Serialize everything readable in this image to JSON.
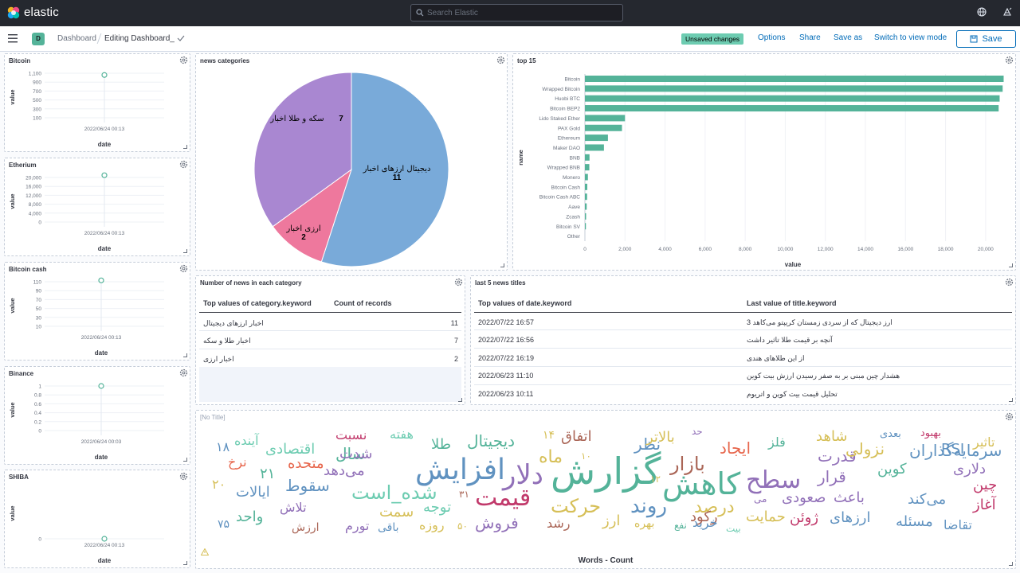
{
  "header": {
    "brand": "elastic",
    "search_placeholder": "Search Elastic"
  },
  "subbar": {
    "avatar_letter": "D",
    "breadcrumb_root": "Dashboard",
    "breadcrumb_current": "Editing Dashboard_",
    "badge": "Unsaved changes",
    "links": [
      "Options",
      "Share",
      "Save as",
      "Switch to view mode"
    ],
    "save_label": "Save"
  },
  "colors": {
    "accent": "#006bb8",
    "bar": "#54b399",
    "pie": [
      "#79aad9",
      "#ee789d",
      "#a987d1"
    ],
    "line_point": "#54b399"
  },
  "mini_charts": [
    {
      "title": "Bitcoin",
      "y_ticks": [
        "1,100",
        "900",
        "700",
        "500",
        "300",
        "100"
      ],
      "x_tick": "2022/06/24 00:13",
      "ylabel": "value",
      "xlabel": "date"
    },
    {
      "title": "Etherium",
      "y_ticks": [
        "20,000",
        "16,000",
        "12,000",
        "8,000",
        "4,000",
        "0"
      ],
      "x_tick": "2022/06/24 00:13",
      "ylabel": "value",
      "xlabel": "date"
    },
    {
      "title": "Bitcoin cash",
      "y_ticks": [
        "110",
        "90",
        "70",
        "50",
        "30",
        "10"
      ],
      "x_tick": "2022/06/24 00:13",
      "ylabel": "value",
      "xlabel": "date"
    },
    {
      "title": "Binance",
      "y_ticks": [
        "1",
        "0.8",
        "0.6",
        "0.4",
        "0.2",
        "0"
      ],
      "x_tick": "2022/06/24 00:03",
      "ylabel": "value",
      "xlabel": "date"
    },
    {
      "title": "SHIBA",
      "y_ticks": [
        "0"
      ],
      "x_tick": "2022/06/24 00:13",
      "ylabel": "value",
      "xlabel": "date"
    }
  ],
  "pie_panel": {
    "title": "news categories"
  },
  "bar_panel": {
    "title": "top 15"
  },
  "count_table": {
    "title": "Number of news in each category",
    "headers": [
      "Top values of category.keyword",
      "Count of records"
    ],
    "rows": [
      [
        "اخبار ارزهای دیجیتال",
        "11"
      ],
      [
        "اخبار طلا و سکه",
        "7"
      ],
      [
        "اخبار ارزی",
        "2"
      ]
    ]
  },
  "news_table": {
    "title": "last 5 news titles",
    "headers": [
      "Top values of date.keyword",
      "Last value of title.keyword"
    ],
    "rows": [
      [
        "2022/07/22 16:57",
        "ارز دیجیتال که از سردی زمستان کریپتو می‌کاهد 3"
      ],
      [
        "2022/07/22 16:56",
        "آنچه بر قیمت طلا تاثیر داشت"
      ],
      [
        "2022/07/22 16:19",
        "از این طلاهای هندی"
      ],
      [
        "2022/06/23 11:10",
        "هشدار چین مبنی بر به صفر رسیدن ارزش بیت کوین"
      ],
      [
        "2022/06/23 10:11",
        "تحلیل قیمت بیت کوین و اتریوم"
      ]
    ]
  },
  "cloud_panel": {
    "title": "[No Title]",
    "footer": "Words - Count"
  },
  "chart_data": [
    {
      "type": "line",
      "title": "Bitcoin",
      "x": [
        "2022/06/24 00:13"
      ],
      "y": [
        1060
      ],
      "xlabel": "date",
      "ylabel": "value",
      "ylim": [
        100,
        1100
      ]
    },
    {
      "type": "line",
      "title": "Etherium",
      "x": [
        "2022/06/24 00:13"
      ],
      "y": [
        21000
      ],
      "xlabel": "date",
      "ylabel": "value",
      "ylim": [
        0,
        20000
      ]
    },
    {
      "type": "line",
      "title": "Bitcoin cash",
      "x": [
        "2022/06/24 00:13"
      ],
      "y": [
        113
      ],
      "xlabel": "date",
      "ylabel": "value",
      "ylim": [
        10,
        110
      ]
    },
    {
      "type": "line",
      "title": "Binance",
      "x": [
        "2022/06/24 00:03"
      ],
      "y": [
        1
      ],
      "xlabel": "date",
      "ylabel": "value",
      "ylim": [
        0,
        1
      ]
    },
    {
      "type": "line",
      "title": "SHIBA",
      "x": [
        "2022/06/24 00:13"
      ],
      "y": [
        0
      ],
      "xlabel": "date",
      "ylabel": "value",
      "ylim": [
        0,
        0
      ]
    },
    {
      "type": "pie",
      "title": "news categories",
      "slices": [
        {
          "label": "دیجیتال ارزهای اخبار",
          "value": 11
        },
        {
          "label": "ارزی اخبار",
          "value": 2
        },
        {
          "label": "سکه و طلا اخبار",
          "value": 7
        }
      ]
    },
    {
      "type": "bar",
      "orientation": "horizontal",
      "title": "top 15",
      "xlabel": "value",
      "ylabel": "name",
      "categories": [
        "Bitcoin",
        "Wrapped Bitcoin",
        "Huobi BTC",
        "Bitcoin BEP2",
        "Lido Staked Ether",
        "PAX Gold",
        "Ethereum",
        "Maker DAO",
        "BNB",
        "Wrapped BNB",
        "Monero",
        "Bitcoin Cash",
        "Bitcoin Cash ABC",
        "Aave",
        "Zcash",
        "Bitcoin SV",
        "Other"
      ],
      "values": [
        20900,
        20850,
        20700,
        20650,
        2000,
        1850,
        1150,
        950,
        230,
        220,
        150,
        120,
        110,
        90,
        60,
        50,
        0
      ],
      "x_ticks": [
        "0",
        "2,000",
        "4,000",
        "6,000",
        "8,000",
        "10,000",
        "12,000",
        "14,000",
        "16,000",
        "18,000",
        "20,000"
      ],
      "xlim": [
        0,
        21000
      ]
    },
    {
      "type": "wordcloud",
      "title": "[No Title]",
      "xlabel": "Words - Count",
      "words": [
        {
          "text": "گزارش",
          "size": 46,
          "color": "#54b399"
        },
        {
          "text": "کاهش",
          "size": 38,
          "color": "#54b399"
        },
        {
          "text": "افزایش",
          "size": 36,
          "color": "#6092c0"
        },
        {
          "text": "دلار",
          "size": 34,
          "color": "#9170b8"
        },
        {
          "text": "قیمت",
          "size": 30,
          "color": "#c1396b"
        },
        {
          "text": "سطح",
          "size": 30,
          "color": "#9170b8"
        },
        {
          "text": "روند",
          "size": 26,
          "color": "#6092c0"
        },
        {
          "text": "حرکت",
          "size": 24,
          "color": "#d6bf57"
        },
        {
          "text": "شده_است",
          "size": 24,
          "color": "#6dccb1"
        },
        {
          "text": "بازار",
          "size": 24,
          "color": "#aa6556"
        },
        {
          "text": "درصد",
          "size": 22,
          "color": "#d6bf57"
        },
        {
          "text": "ماه",
          "size": 22,
          "color": "#d6bf57"
        },
        {
          "text": "دیجیتال",
          "size": 20,
          "color": "#54b399"
        },
        {
          "text": "ایجاد",
          "size": 20,
          "color": "#e7664c"
        },
        {
          "text": "نظر",
          "size": 20,
          "color": "#6092c0"
        },
        {
          "text": "سقوط",
          "size": 20,
          "color": "#6092c0"
        },
        {
          "text": "فروش",
          "size": 20,
          "color": "#9170b8"
        },
        {
          "text": "قرار",
          "size": 20,
          "color": "#9170b8"
        },
        {
          "text": "قدرت",
          "size": 20,
          "color": "#9170b8"
        },
        {
          "text": "نزولی",
          "size": 20,
          "color": "#d6bf57"
        },
        {
          "text": "سرمایه‌گذاران",
          "size": 20,
          "color": "#6092c0"
        },
        {
          "text": "سال",
          "size": 20,
          "color": "#54b399"
        },
        {
          "text": "شدت",
          "size": 18,
          "color": "#9170b8"
        },
        {
          "text": "می‌دهد",
          "size": 18,
          "color": "#9170b8"
        },
        {
          "text": "صعودی",
          "size": 18,
          "color": "#9170b8"
        },
        {
          "text": "باعث",
          "size": 18,
          "color": "#9170b8"
        },
        {
          "text": "حمایت",
          "size": 18,
          "color": "#d6bf57"
        },
        {
          "text": "رکود",
          "size": 18,
          "color": "#aa6556"
        },
        {
          "text": "اتفاق",
          "size": 18,
          "color": "#aa6556"
        },
        {
          "text": "طلا",
          "size": 18,
          "color": "#54b399"
        },
        {
          "text": "اقتصادی",
          "size": 18,
          "color": "#6dccb1"
        },
        {
          "text": "متحده",
          "size": 18,
          "color": "#e7664c"
        },
        {
          "text": "ایالات",
          "size": 18,
          "color": "#6092c0"
        },
        {
          "text": "کوین",
          "size": 18,
          "color": "#54b399"
        },
        {
          "text": "می‌کند",
          "size": 18,
          "color": "#6092c0"
        },
        {
          "text": "دلاری",
          "size": 18,
          "color": "#9170b8"
        },
        {
          "text": "RSI",
          "size": 18,
          "color": "#6092c0"
        },
        {
          "text": "شاهد",
          "size": 18,
          "color": "#d6bf57"
        },
        {
          "text": "چین",
          "size": 18,
          "color": "#c1396b"
        },
        {
          "text": "آغاز",
          "size": 18,
          "color": "#c1396b"
        },
        {
          "text": "ژوئن",
          "size": 18,
          "color": "#c1396b"
        },
        {
          "text": "ارزهای",
          "size": 18,
          "color": "#6092c0"
        },
        {
          "text": "مسئله",
          "size": 18,
          "color": "#6092c0"
        },
        {
          "text": "خرید",
          "size": 16,
          "color": "#6092c0"
        },
        {
          "text": "بالاتر",
          "size": 18,
          "color": "#d6bf57"
        },
        {
          "text": "تلاش",
          "size": 16,
          "color": "#9170b8"
        },
        {
          "text": "سمت",
          "size": 18,
          "color": "#d6bf57"
        },
        {
          "text": "توجه",
          "size": 18,
          "color": "#6dccb1"
        },
        {
          "text": "واحد",
          "size": 18,
          "color": "#54b399"
        },
        {
          "text": "تورم",
          "size": 16,
          "color": "#9170b8"
        },
        {
          "text": "روزه",
          "size": 16,
          "color": "#d6bf57"
        },
        {
          "text": "رشد",
          "size": 16,
          "color": "#aa6556"
        },
        {
          "text": "ارز",
          "size": 18,
          "color": "#d6bf57"
        },
        {
          "text": "بهره",
          "size": 14,
          "color": "#d6bf57"
        },
        {
          "text": "نرخ",
          "size": 16,
          "color": "#e7664c"
        },
        {
          "text": "آینده",
          "size": 16,
          "color": "#6dccb1"
        },
        {
          "text": "نسبت",
          "size": 16,
          "color": "#c1396b"
        },
        {
          "text": "هفته",
          "size": 16,
          "color": "#6dccb1"
        },
        {
          "text": "فلز",
          "size": 16,
          "color": "#54b399"
        },
        {
          "text": "بهبود",
          "size": 13,
          "color": "#c1396b"
        },
        {
          "text": "بعدی",
          "size": 13,
          "color": "#6092c0"
        },
        {
          "text": "تاثیر",
          "size": 16,
          "color": "#d6bf57"
        },
        {
          "text": "تقاضا",
          "size": 16,
          "color": "#6092c0"
        },
        {
          "text": "باقی",
          "size": 14,
          "color": "#6092c0"
        },
        {
          "text": "نفع",
          "size": 12,
          "color": "#54b399"
        },
        {
          "text": "بیت",
          "size": 12,
          "color": "#6dccb1"
        },
        {
          "text": "ارزش",
          "size": 14,
          "color": "#aa6556"
        },
        {
          "text": "حد",
          "size": 12,
          "color": "#9170b8"
        },
        {
          "text": "می",
          "size": 12,
          "color": "#9170b8"
        },
        {
          "text": "۱۸",
          "size": 16,
          "color": "#6092c0"
        },
        {
          "text": "۲۰",
          "size": 16,
          "color": "#d6bf57"
        },
        {
          "text": "۲۱",
          "size": 18,
          "color": "#54b399"
        },
        {
          "text": "۱۴",
          "size": 14,
          "color": "#d6bf57"
        },
        {
          "text": "۱۰",
          "size": 12,
          "color": "#d6bf57"
        },
        {
          "text": "۱۲",
          "size": 12,
          "color": "#d6bf57"
        },
        {
          "text": "۳۱",
          "size": 12,
          "color": "#aa6556"
        },
        {
          "text": "۷۵",
          "size": 14,
          "color": "#6092c0"
        },
        {
          "text": "۵۰",
          "size": 12,
          "color": "#d6bf57"
        }
      ]
    }
  ]
}
